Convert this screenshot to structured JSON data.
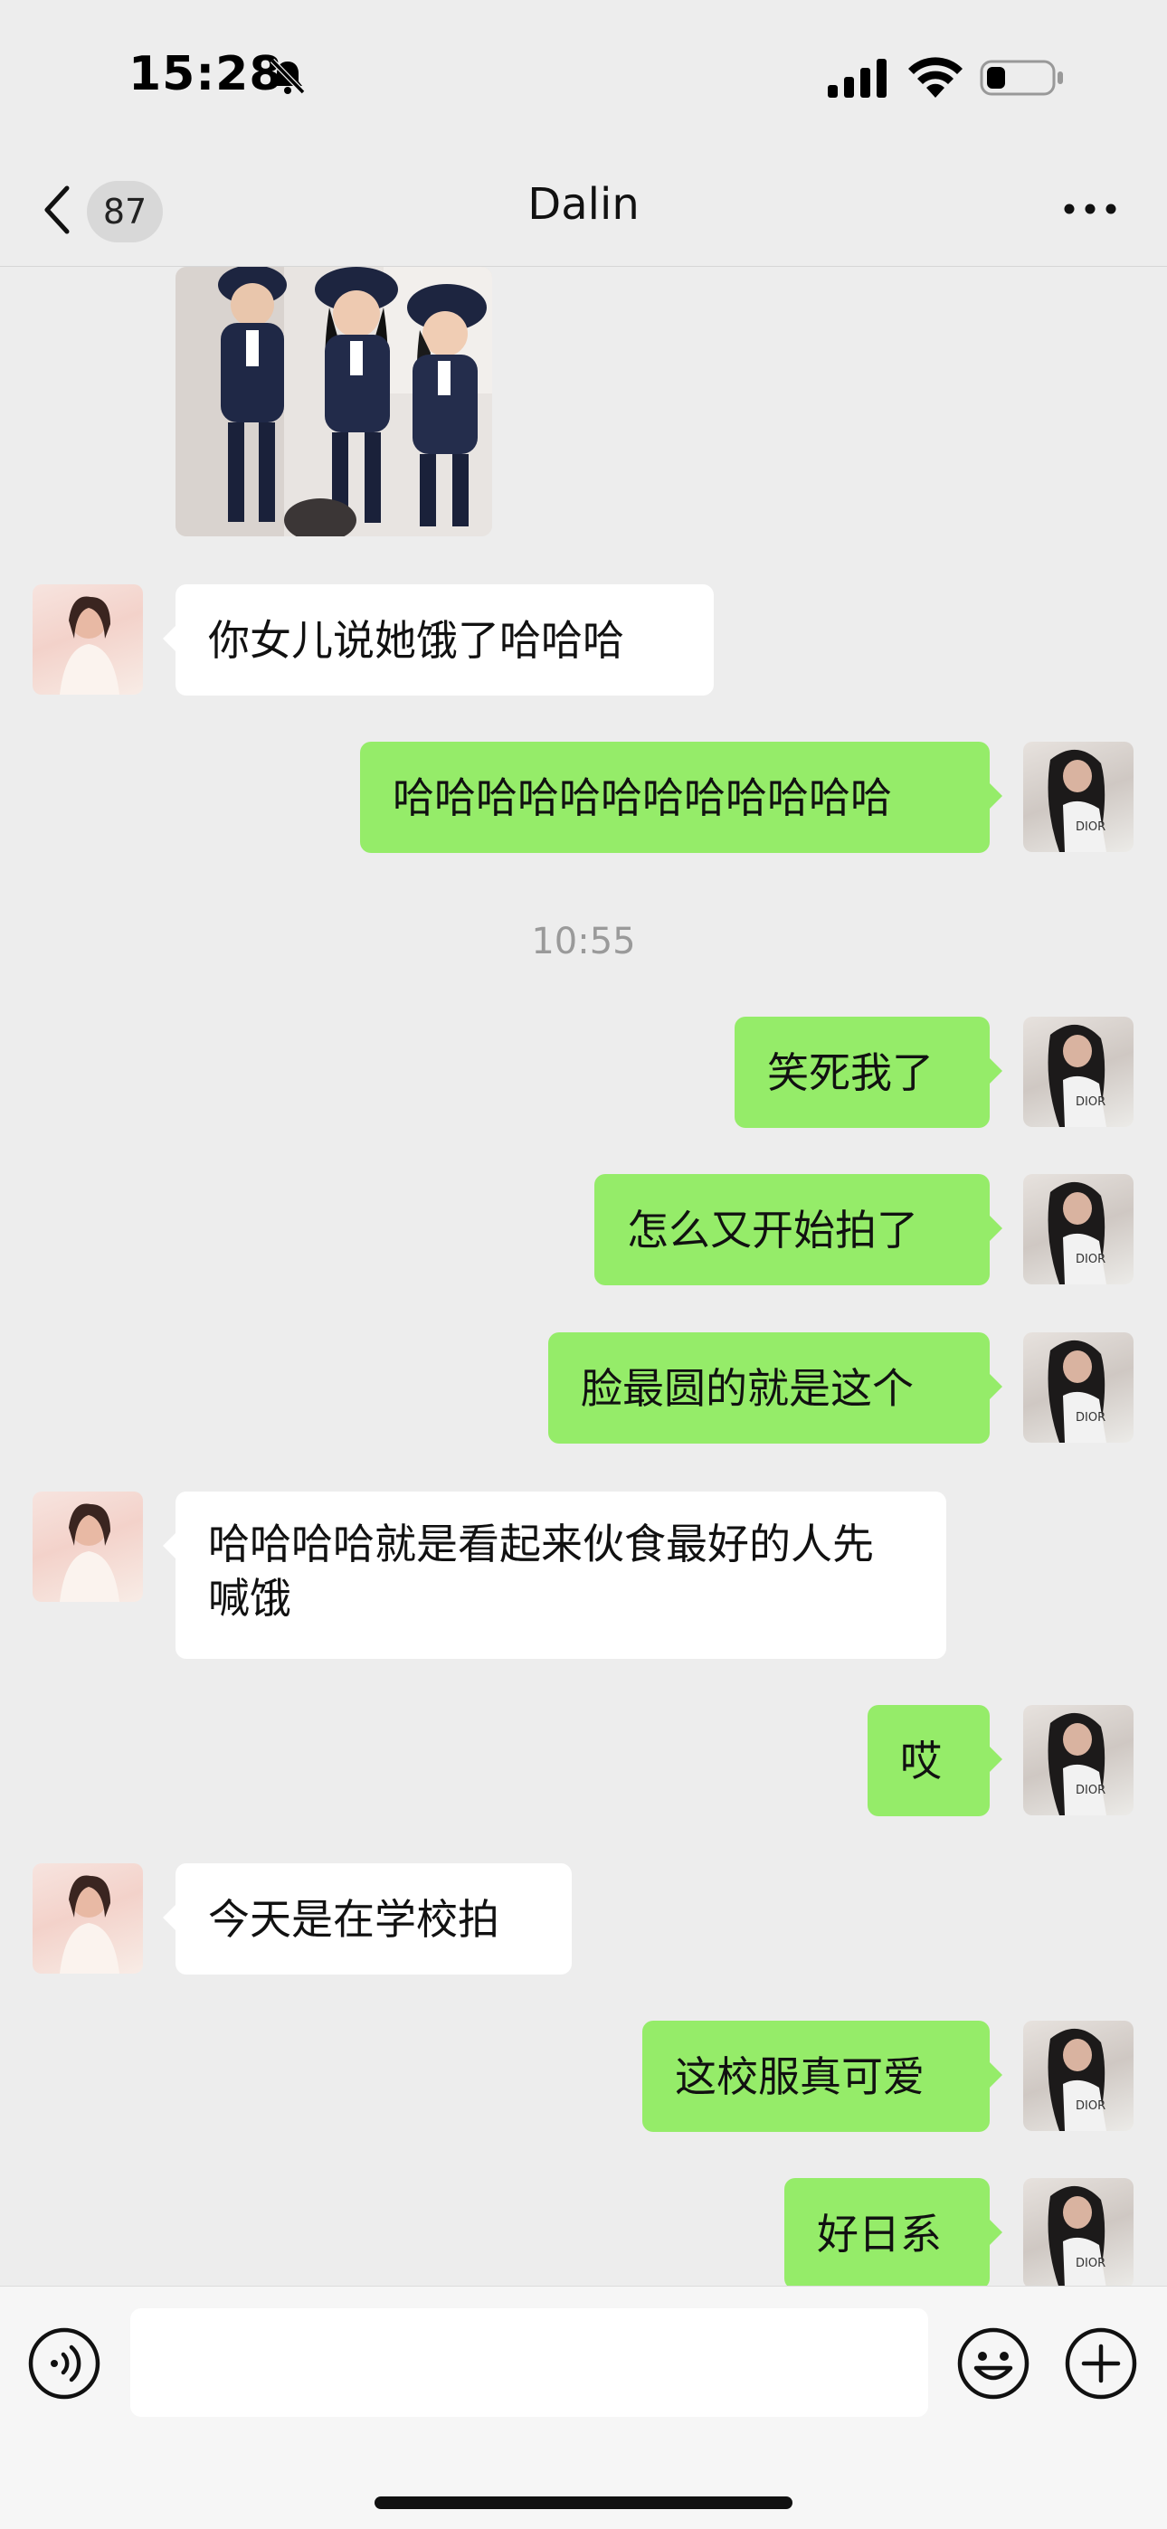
{
  "status_bar": {
    "time": "15:28",
    "icons": [
      "bell-off-icon",
      "signal-icon",
      "wifi-icon",
      "battery-icon"
    ]
  },
  "nav": {
    "back_icon": "chevron-left-icon",
    "unread_count": "87",
    "title": "Dalin",
    "more_icon": "ellipsis-icon"
  },
  "messages": [
    {
      "type": "image",
      "from": "me",
      "description_icon": "photo"
    },
    {
      "type": "text",
      "from": "them",
      "text": "你女儿说她饿了哈哈哈"
    },
    {
      "type": "text",
      "from": "me",
      "text": "哈哈哈哈哈哈哈哈哈哈哈哈"
    },
    {
      "type": "time",
      "text": "10:55"
    },
    {
      "type": "text",
      "from": "me",
      "text": "笑死我了"
    },
    {
      "type": "text",
      "from": "me",
      "text": "怎么又开始拍了"
    },
    {
      "type": "text",
      "from": "me",
      "text": "脸最圆的就是这个"
    },
    {
      "type": "text",
      "from": "them",
      "text": "哈哈哈哈就是看起来伙食最好的人先喊饿"
    },
    {
      "type": "text",
      "from": "me",
      "text": "哎"
    },
    {
      "type": "text",
      "from": "them",
      "text": "今天是在学校拍"
    },
    {
      "type": "text",
      "from": "me",
      "text": "这校服真可爱"
    },
    {
      "type": "text",
      "from": "me",
      "text": "好日系"
    }
  ],
  "input_bar": {
    "voice_icon": "voice-icon",
    "text_value": "",
    "emoji_icon": "emoji-icon",
    "plus_icon": "plus-icon"
  },
  "colors": {
    "outgoing_bubble": "#95ec69",
    "incoming_bubble": "#ffffff",
    "background": "#ededed"
  }
}
